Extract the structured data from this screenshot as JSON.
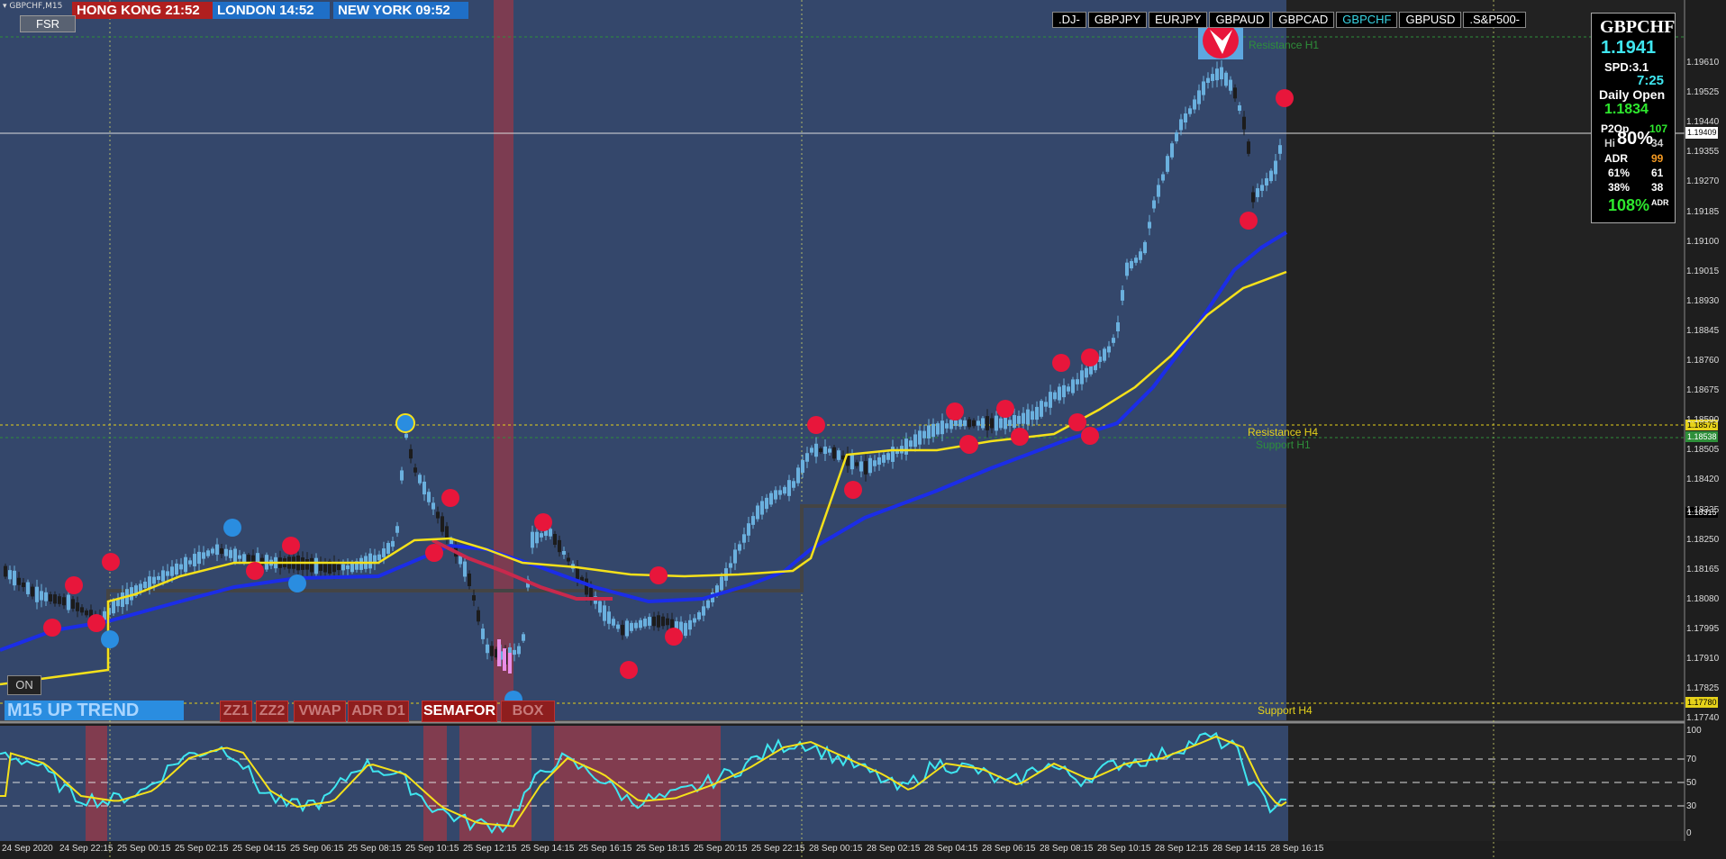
{
  "symbol_label": "GBPCHF,M15",
  "clocks": [
    {
      "label": "HONG KONG 21:52",
      "bg": "#b01f1f"
    },
    {
      "label": "LONDON  14:52",
      "bg": "#1f6fc7"
    },
    {
      "label": "NEW YORK 09:52",
      "bg": "#1f6fc7"
    }
  ],
  "fsr_label": "FSR",
  "symbol_tabs": [
    ".DJ-",
    "GBPJPY",
    "EURJPY",
    "GBPAUD",
    "GBPCAD",
    "GBPCHF",
    "GBPUSD",
    ".S&P500-"
  ],
  "active_tab": "GBPCHF",
  "info_panel": {
    "symbol": "GBPCHF",
    "price": "1.1941",
    "spread": "SPD:3.1",
    "timer": "7:25",
    "daily_open_label": "Daily Open",
    "daily_open": "1.1834",
    "p2op_label": "P2Op",
    "p2op": "107",
    "pct_overlay": "80%",
    "hi_label": "Hi",
    "hi": "34",
    "adr_label": "ADR",
    "adr": "99",
    "l61_label": "61%",
    "l61": "61",
    "l38_label": "38%",
    "l38": "38",
    "adr_pct": "108%",
    "adr_suffix": "ADR"
  },
  "levels": {
    "resistance_h1": "Resistance H1",
    "resistance_h4": "Resistance H4",
    "support_h1": "Support H1",
    "support_h4": "Support H4"
  },
  "price_labels": {
    "current": "1.19409",
    "res_h4": "1.18575",
    "sup_h1": "1.18538",
    "mid": "1.18315",
    "sup_h4": "1.17780"
  },
  "y_ticks": [
    "1.19610",
    "1.19525",
    "1.19440",
    "1.19355",
    "1.19270",
    "1.19185",
    "1.19100",
    "1.19015",
    "1.18930",
    "1.18845",
    "1.18760",
    "1.18675",
    "1.18590",
    "1.18505",
    "1.18420",
    "1.18335",
    "1.18250",
    "1.18165",
    "1.18080",
    "1.17995",
    "1.17910",
    "1.17825",
    "1.17740"
  ],
  "osc_ticks": [
    "100",
    "70",
    "50",
    "30",
    "0"
  ],
  "x_ticks": [
    "24 Sep 2020",
    "24 Sep 22:15",
    "25 Sep 00:15",
    "25 Sep 02:15",
    "25 Sep 04:15",
    "25 Sep 06:15",
    "25 Sep 08:15",
    "25 Sep 10:15",
    "25 Sep 12:15",
    "25 Sep 14:15",
    "25 Sep 16:15",
    "25 Sep 18:15",
    "25 Sep 20:15",
    "25 Sep 22:15",
    "28 Sep 00:15",
    "28 Sep 02:15",
    "28 Sep 04:15",
    "28 Sep 06:15",
    "28 Sep 08:15",
    "28 Sep 10:15",
    "28 Sep 12:15",
    "28 Sep 14:15",
    "28 Sep 16:15"
  ],
  "buttons": [
    "ZZ1",
    "ZZ2",
    "VWAP",
    "ADR D1",
    "SEMAFOR",
    "BOX"
  ],
  "trend_label": "M15   UP TREND",
  "on_label": "ON",
  "colors": {
    "bg": "#34476b",
    "future_bg": "#222222",
    "ma_yellow": "#f5e11a",
    "ma_blue": "#1b2de8",
    "bull": "#6ab0de",
    "bear": "#1c1c1c",
    "dot_red": "#e8163b",
    "dot_blue": "#2a8de0",
    "cyan": "#3fe6f0"
  }
}
